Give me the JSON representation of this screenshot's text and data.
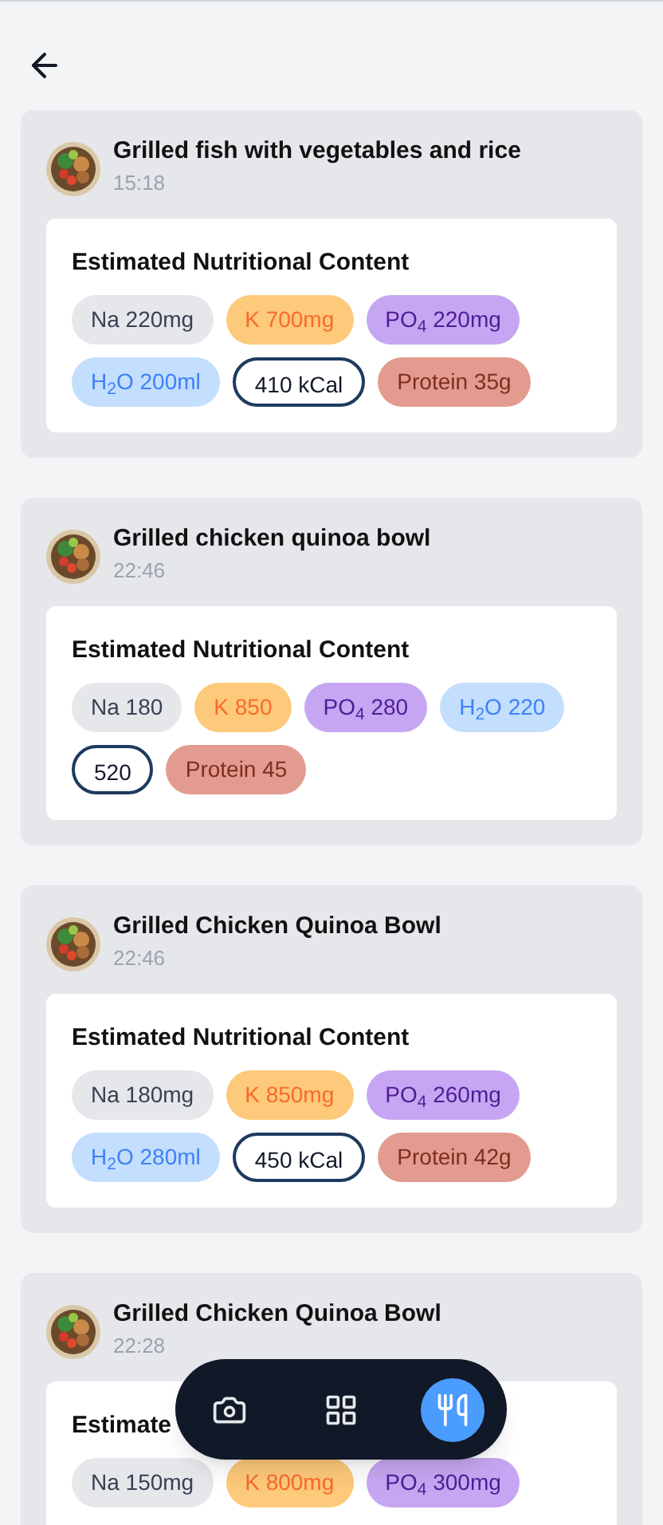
{
  "meals": [
    {
      "title": "Grilled fish with vegetables and rice",
      "time": "15:18",
      "heading": "Estimated Nutritional Content",
      "nutrients": [
        {
          "kind": "na",
          "text": "Na 220mg"
        },
        {
          "kind": "k",
          "text": "K 700mg"
        },
        {
          "kind": "po4",
          "text": "PO$_{4}$ 220mg"
        },
        {
          "kind": "h2o",
          "text": "H$_{2}$O 200ml"
        },
        {
          "kind": "kcal",
          "text": "410 kCal"
        },
        {
          "kind": "protein",
          "text": "Protein 35g"
        }
      ]
    },
    {
      "title": "Grilled chicken quinoa bowl",
      "time": "22:46",
      "heading": "Estimated Nutritional Content",
      "nutrients": [
        {
          "kind": "na",
          "text": "Na 180"
        },
        {
          "kind": "k",
          "text": "K 850"
        },
        {
          "kind": "po4",
          "text": "PO$_{4}$ 280"
        },
        {
          "kind": "h2o",
          "text": "H$_{2}$O 220"
        },
        {
          "kind": "kcal",
          "text": "520"
        },
        {
          "kind": "protein",
          "text": "Protein 45"
        }
      ]
    },
    {
      "title": "Grilled Chicken Quinoa Bowl",
      "time": "22:46",
      "heading": "Estimated Nutritional Content",
      "nutrients": [
        {
          "kind": "na",
          "text": "Na 180mg"
        },
        {
          "kind": "k",
          "text": "K 850mg"
        },
        {
          "kind": "po4",
          "text": "PO$_{4}$ 260mg"
        },
        {
          "kind": "h2o",
          "text": "H$_{2}$O 280ml"
        },
        {
          "kind": "kcal",
          "text": "450 kCal"
        },
        {
          "kind": "protein",
          "text": "Protein 42g"
        }
      ]
    },
    {
      "title": "Grilled Chicken Quinoa Bowl",
      "time": "22:28",
      "heading": "Estimate",
      "nutrients": [
        {
          "kind": "na",
          "text": "Na 150mg"
        },
        {
          "kind": "k",
          "text": "K 800mg"
        },
        {
          "kind": "po4",
          "text": "PO$_{4}$ 300mg"
        }
      ]
    }
  ],
  "nav": [
    {
      "kind": "camera",
      "selected": false
    },
    {
      "kind": "grid",
      "selected": false
    },
    {
      "kind": "meals",
      "selected": true
    }
  ]
}
